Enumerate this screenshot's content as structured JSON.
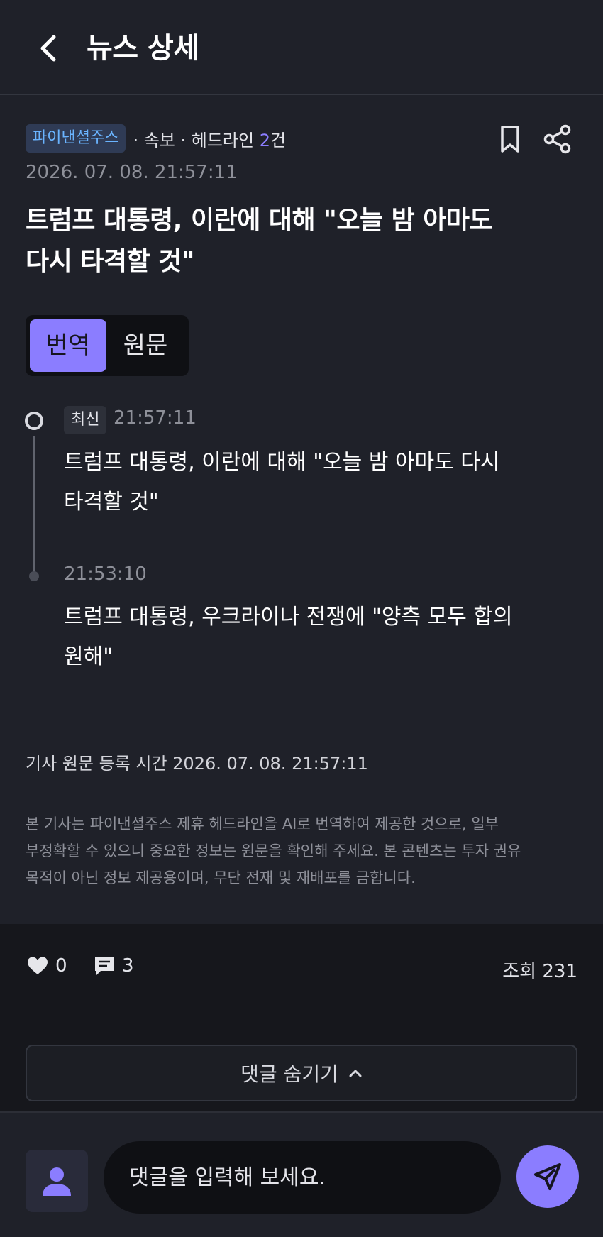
{
  "header": {
    "title": "뉴스 상세"
  },
  "article": {
    "source": "파이낸셜주스",
    "meta_prefix": "· 속보 · 헤드라인 ",
    "meta_count": "2",
    "meta_suffix": "건",
    "datetime": "2026. 07. 08. 21:57:11",
    "headline_line1": "트럼프 대통령, 이란에 대해 \"오늘 밤 아마도",
    "headline_line2": "다시 타격할 것\""
  },
  "toggle": {
    "translated": "번역",
    "original": "원문"
  },
  "timeline": {
    "items": [
      {
        "badge": "최신",
        "time": "21:57:11",
        "text_line1": "트럼프 대통령, 이란에 대해 \"오늘 밤 아마도 다시",
        "text_line2": "타격할 것\""
      },
      {
        "time": "21:53:10",
        "text_line1": "트럼프 대통령, 우크라이나 전쟁에 \"양측 모두 합의",
        "text_line2": "원해\""
      }
    ]
  },
  "footer_info": {
    "registered": "기사 원문 등록 시간 2026. 07. 08. 21:57:11",
    "disclaimer_line1": "본 기사는 파이낸셜주스 제휴 헤드라인을 AI로 번역하여 제공한 것으로, 일부",
    "disclaimer_line2": "부정확할 수 있으니 중요한 정보는 원문을 확인해 주세요. 본 콘텐츠는 투자 권유",
    "disclaimer_line3": "목적이 아닌 정보 제공용이며, 무단 전재 및 재배포를 금합니다."
  },
  "reactions": {
    "likes": "0",
    "comments": "3",
    "views": "조회 231"
  },
  "comments_toggle": {
    "label": "댓글 숨기기"
  },
  "comment_input": {
    "placeholder": "댓글을 입력해 보세요."
  },
  "colors": {
    "accent": "#8b7dff",
    "source_badge_text": "#6ab4ff",
    "background": "#1f2129"
  },
  "icons": {
    "back": "chevron-left-icon",
    "bookmark": "bookmark-icon",
    "share": "share-icon",
    "like": "heart-icon",
    "comment": "comment-icon",
    "chevron_up": "chevron-up-icon",
    "avatar": "user-icon",
    "send": "send-icon"
  }
}
